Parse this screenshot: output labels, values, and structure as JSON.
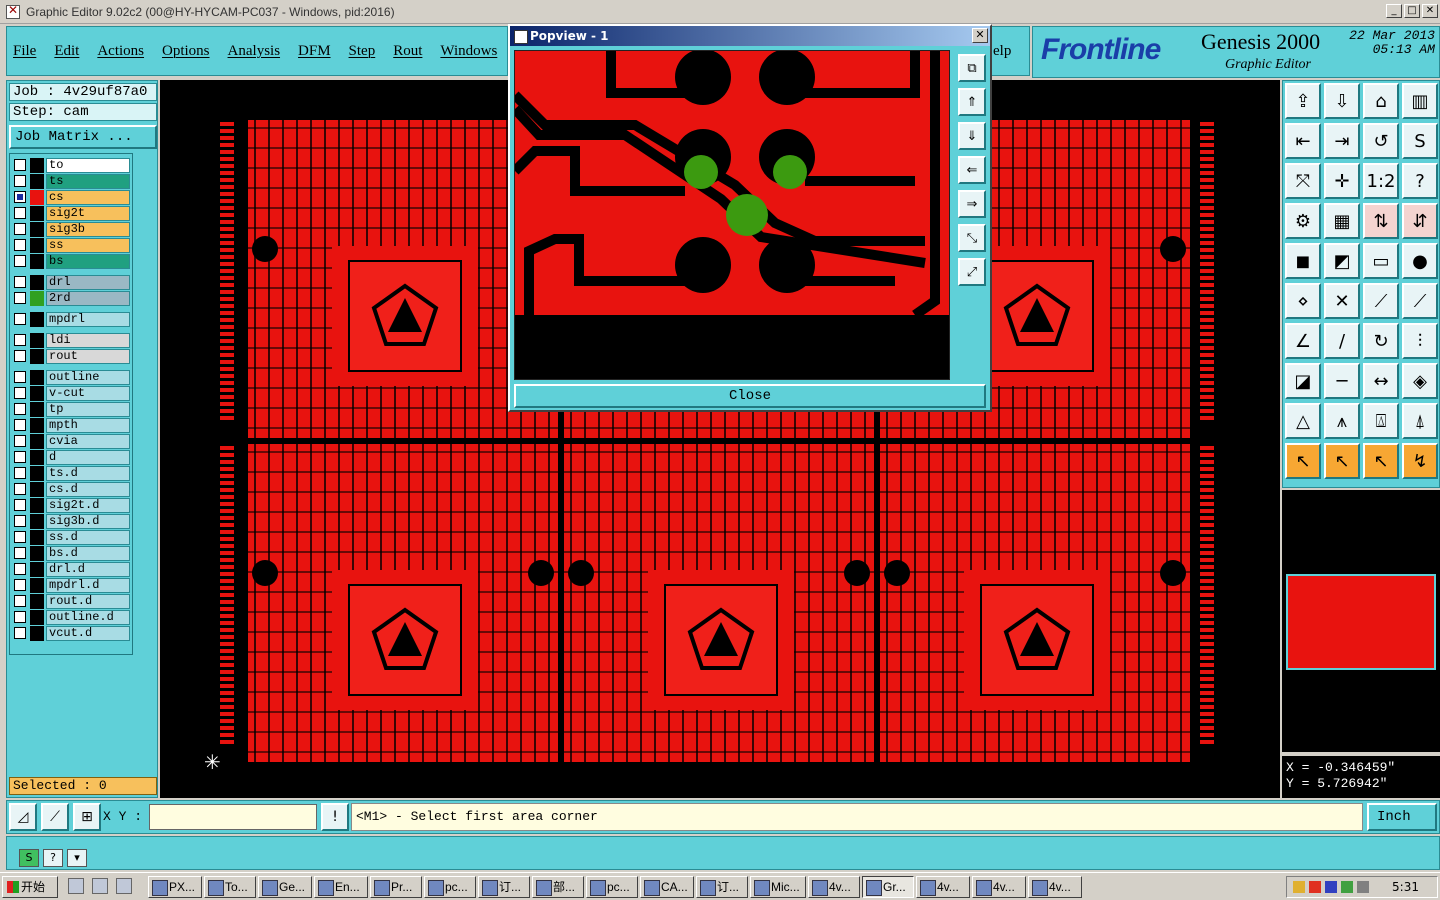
{
  "window": {
    "title": "Graphic Editor 9.02c2 (00@HY-HYCAM-PC037 - Windows, pid:2016)"
  },
  "menu": {
    "items": [
      "File",
      "Edit",
      "Actions",
      "Options",
      "Analysis",
      "DFM",
      "Step",
      "Rout",
      "Windows"
    ],
    "help": "elp"
  },
  "brand": {
    "logo": "Frontline",
    "product": "Genesis 2000",
    "subtitle": "Graphic Editor",
    "date": "22 Mar 2013",
    "time": "05:13 AM"
  },
  "job": {
    "job_line": "Job : 4v29uf87a0",
    "step_line": "Step: cam",
    "matrix_button": "Job Matrix ..."
  },
  "layers": [
    {
      "name": "to",
      "bg": "#ffffff",
      "swatch": "#000000",
      "checked": false
    },
    {
      "name": "ts",
      "bg": "#20a080",
      "swatch": "#000000",
      "checked": false
    },
    {
      "name": "cs",
      "bg": "#f7c05c",
      "swatch": "#e8130f",
      "checked": true
    },
    {
      "name": "sig2t",
      "bg": "#f7c05c",
      "swatch": "#000000",
      "checked": false
    },
    {
      "name": "sig3b",
      "bg": "#f7c05c",
      "swatch": "#000000",
      "checked": false
    },
    {
      "name": "ss",
      "bg": "#f7c05c",
      "swatch": "#000000",
      "checked": false
    },
    {
      "name": "bs",
      "bg": "#20a080",
      "swatch": "#000000",
      "checked": false
    },
    {
      "name": "drl",
      "bg": "#9ab8c4",
      "swatch": "#000000",
      "checked": false
    },
    {
      "name": "2rd",
      "bg": "#9ab8c4",
      "swatch": "#30a020",
      "checked": false
    },
    {
      "name": "mpdrl",
      "bg": "#a8dce4",
      "swatch": "#000000",
      "checked": false
    },
    {
      "name": "ldi",
      "bg": "#d8d8d8",
      "swatch": "#000000",
      "checked": false
    },
    {
      "name": "rout",
      "bg": "#d8d8d8",
      "swatch": "#000000",
      "checked": false
    },
    {
      "name": "outline",
      "bg": "#a8dce4",
      "swatch": "#000000",
      "checked": false
    },
    {
      "name": "v-cut",
      "bg": "#a8dce4",
      "swatch": "#000000",
      "checked": false
    },
    {
      "name": "tp",
      "bg": "#a8dce4",
      "swatch": "#000000",
      "checked": false
    },
    {
      "name": "mpth",
      "bg": "#a8dce4",
      "swatch": "#000000",
      "checked": false
    },
    {
      "name": "cvia",
      "bg": "#a8dce4",
      "swatch": "#000000",
      "checked": false
    },
    {
      "name": "d",
      "bg": "#a8dce4",
      "swatch": "#000000",
      "checked": false
    },
    {
      "name": "ts.d",
      "bg": "#a8dce4",
      "swatch": "#000000",
      "checked": false
    },
    {
      "name": "cs.d",
      "bg": "#a8dce4",
      "swatch": "#000000",
      "checked": false
    },
    {
      "name": "sig2t.d",
      "bg": "#a8dce4",
      "swatch": "#000000",
      "checked": false
    },
    {
      "name": "sig3b.d",
      "bg": "#a8dce4",
      "swatch": "#000000",
      "checked": false
    },
    {
      "name": "ss.d",
      "bg": "#a8dce4",
      "swatch": "#000000",
      "checked": false
    },
    {
      "name": "bs.d",
      "bg": "#a8dce4",
      "swatch": "#000000",
      "checked": false
    },
    {
      "name": "drl.d",
      "bg": "#a8dce4",
      "swatch": "#000000",
      "checked": false
    },
    {
      "name": "mpdrl.d",
      "bg": "#a8dce4",
      "swatch": "#000000",
      "checked": false
    },
    {
      "name": "rout.d",
      "bg": "#a8dce4",
      "swatch": "#000000",
      "checked": false
    },
    {
      "name": "outline.d",
      "bg": "#a8dce4",
      "swatch": "#000000",
      "checked": false
    },
    {
      "name": "vcut.d",
      "bg": "#a8dce4",
      "swatch": "#000000",
      "checked": false
    }
  ],
  "selected": "Selected : 0",
  "popup": {
    "title": "Popview - 1",
    "close_label": "Close"
  },
  "coords": {
    "x": "X = -0.346459\"",
    "y": "Y = 5.726942\""
  },
  "command": {
    "xy_label": "X Y :",
    "xy_value": "",
    "prompt": "<M1> - Select first area corner",
    "units": "Inch"
  },
  "taskbar": {
    "start": "开始",
    "tasks": [
      "PX...",
      "To...",
      "Ge...",
      "En...",
      "Pr...",
      "pc...",
      "订...",
      "部...",
      "pc...",
      "CA...",
      "订...",
      "Mic...",
      "4v...",
      "Gr...",
      "4v...",
      "4v...",
      "4v..."
    ],
    "active_index": 13,
    "clock": "5:31"
  },
  "colors": {
    "panel": "#5fd0d8",
    "copper": "#e8130f",
    "drill": "#3c9a10",
    "highlight": "#f7a733"
  }
}
